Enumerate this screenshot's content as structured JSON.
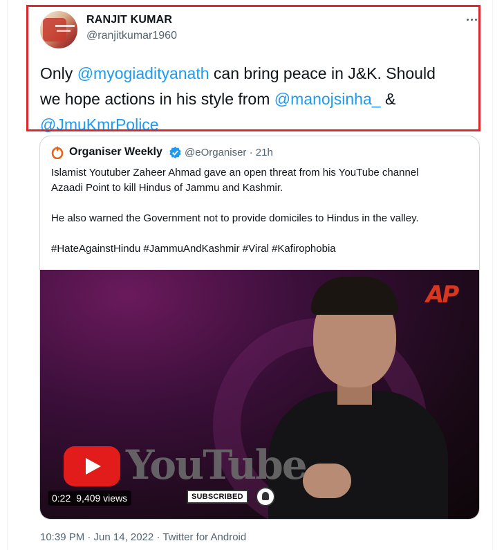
{
  "tweet": {
    "author_name": "RANJIT KUMAR",
    "author_handle": "@ranjitkumar1960",
    "text_lines": [
      [
        {
          "t": "Only "
        },
        {
          "t": "@myogiadityanath",
          "mention": true
        },
        {
          "t": " can bring peace in J&K. Should"
        }
      ],
      [
        {
          "t": "we hope actions in his style from "
        },
        {
          "t": "@manojsinha_",
          "mention": true
        },
        {
          "t": "  &"
        }
      ],
      [
        {
          "t": "@JmuKmrPolice",
          "mention": true
        }
      ]
    ],
    "timestamp": "10:39 PM · Jun 14, 2022 · Twitter for Android"
  },
  "quote": {
    "author_name": "Organiser Weekly",
    "author_handle": "@eOrganiser",
    "time_ago": "21h",
    "meta": "@eOrganiser · 21h",
    "paragraph1_line1": "Islamist Youtuber Zaheer Ahmad gave an open threat from his YouTube channel",
    "paragraph1_line2": "Azaadi Point to kill Hindus of Jammu and Kashmir.",
    "paragraph2": "He also warned the Government not to provide domiciles to Hindus in the valley.",
    "hashtags": "#HateAgainstHindu #JammuAndKashmir #Viral #Kafirophobia"
  },
  "video": {
    "duration": "0:22",
    "views": "9,409 views",
    "watermark": "AP",
    "overlay_word": "YouTube",
    "subscribed_label": "SUBSCRIBED"
  },
  "colors": {
    "mention": "#1d9bf0",
    "highlight_box": "#e0262d",
    "secondary_text": "#536471"
  },
  "icons": [
    "more-icon",
    "organiser-logo-icon",
    "verified-badge-icon",
    "youtube-play-icon",
    "bell-icon"
  ]
}
